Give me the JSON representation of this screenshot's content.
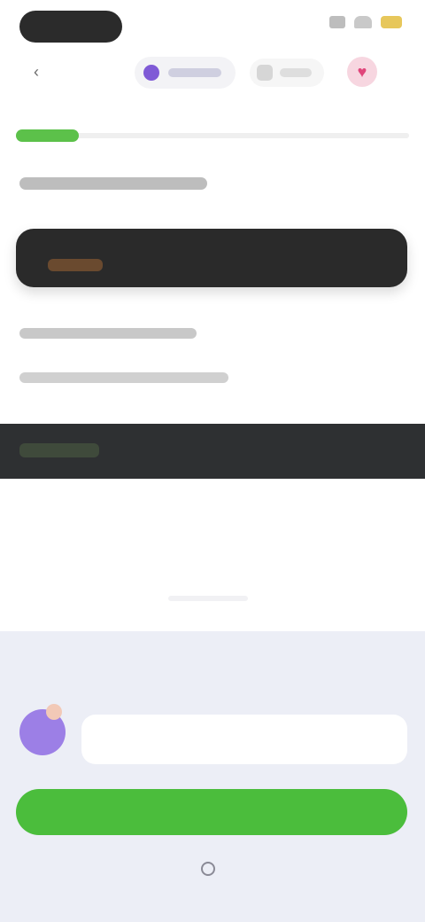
{
  "status_bar": {
    "battery_color": "#e7c75b"
  },
  "header": {
    "back_icon": "chevron-left-icon",
    "chip_ai_icon": "ai-avatar-icon",
    "chip_mid_icon": "document-icon",
    "heart_icon": "heart-icon"
  },
  "lesson": {
    "progress": 0.16,
    "progress_color": "#5cc14a"
  },
  "panel": {
    "title": "",
    "bubble_text": "",
    "bubble_highlight": "",
    "cta_label": "",
    "footer_text": "",
    "cta_color": "#4bbd3c"
  }
}
